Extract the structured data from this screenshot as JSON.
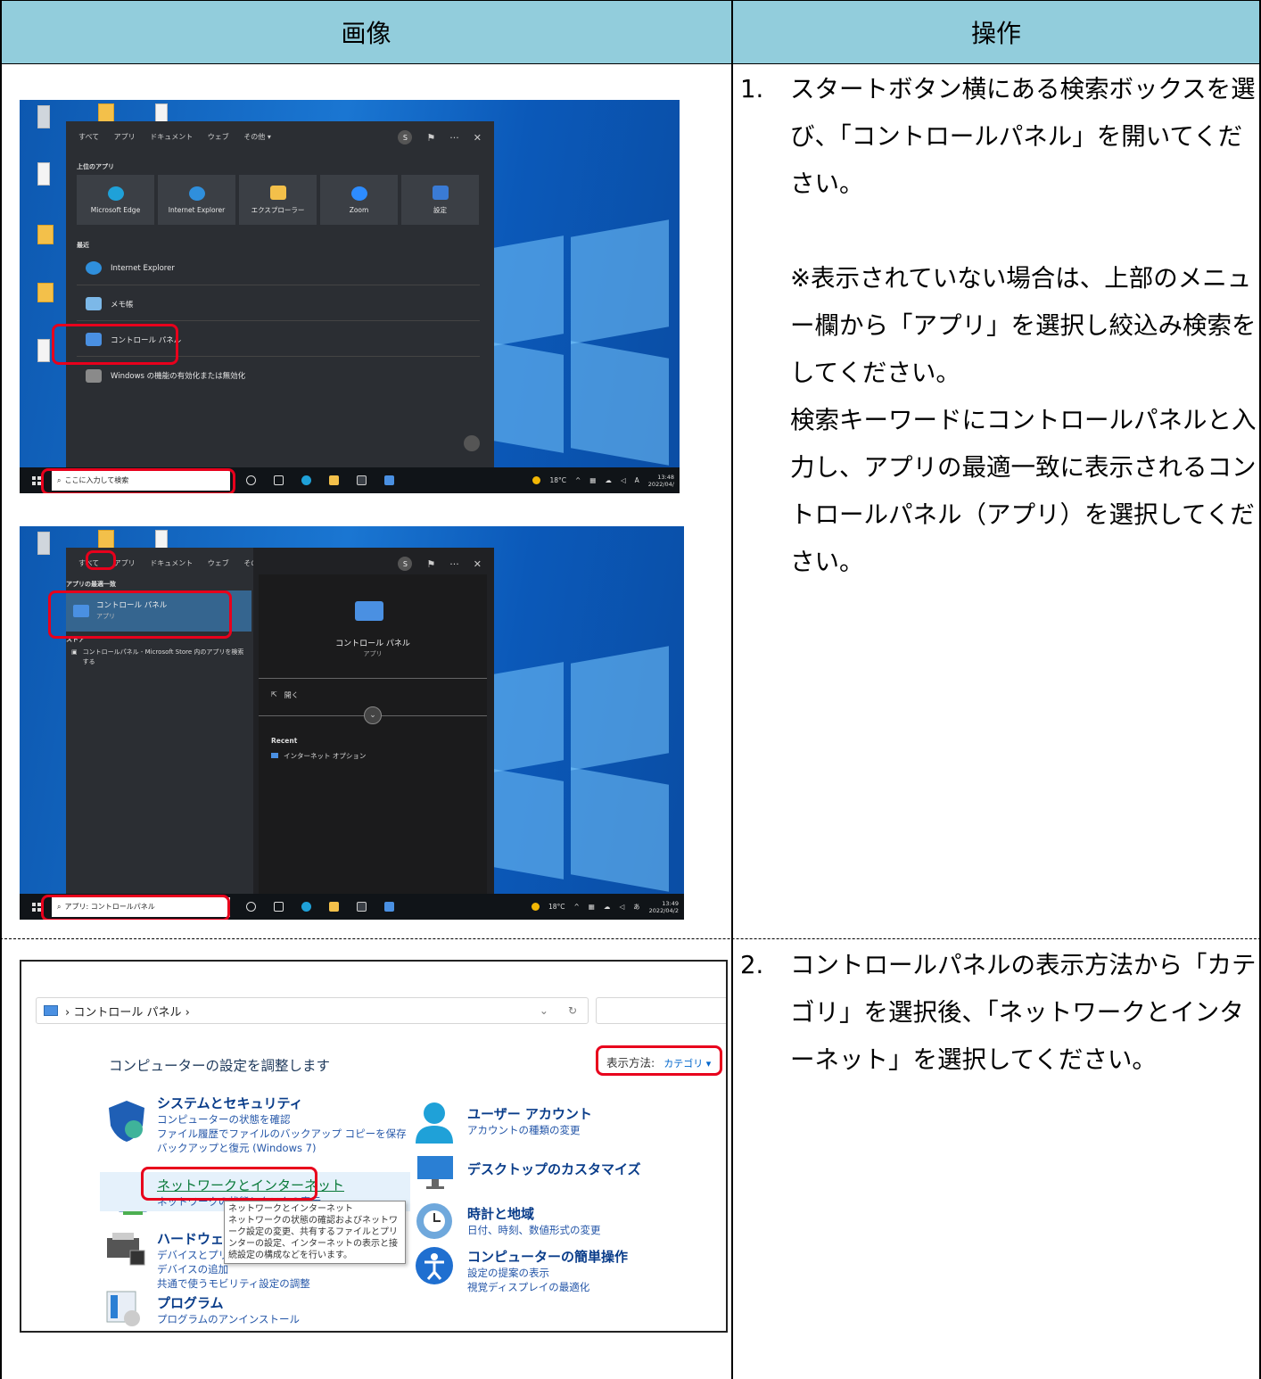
{
  "header": {
    "image_col": "画像",
    "operation_col": "操作"
  },
  "step1": {
    "num": "1.",
    "line1": "スタートボタン横にある検索ボックスを選び、「コントロールパネル」を開いてください。",
    "note1": "※表示されていない場合は、上部のメニュー欄から「アプリ」を選択し絞込み検索をしてください。",
    "note2": "検索キーワードにコントロールパネルと入力し、アプリの最適一致に表示されるコントロールパネル（アプリ）を選択してください。"
  },
  "step2": {
    "num": "2.",
    "line1": "コントロールパネルの表示方法から「カテゴリ」を選択後、「ネットワークとインターネット」を選択してください。"
  },
  "shot1": {
    "tabs": [
      "すべて",
      "アプリ",
      "ドキュメント",
      "ウェブ",
      "その他 ▾"
    ],
    "avatar": "S",
    "top_apps_label": "上位のアプリ",
    "tiles": [
      {
        "label": "Microsoft Edge",
        "color": "#1fa1d8"
      },
      {
        "label": "Internet Explorer",
        "color": "#2f8fdc"
      },
      {
        "label": "エクスプローラー",
        "color": "#f3c04a"
      },
      {
        "label": "Zoom",
        "color": "#2d8cff"
      },
      {
        "label": "設定",
        "color": "#3a7bd5"
      }
    ],
    "recent_label": "最近",
    "recent": [
      {
        "label": "Internet Explorer",
        "color": "#2f8fdc"
      },
      {
        "label": "メモ帳",
        "color": "#7cb8e8"
      },
      {
        "label": "コントロール パネル",
        "color": "#4a90e2"
      },
      {
        "label": "Windows の機能の有効化または無効化",
        "color": "#8a8a8a"
      }
    ],
    "search_text": "ここに入力して検索",
    "temp": "18°C",
    "ime": "A",
    "time": "13:48",
    "date": "2022/04/"
  },
  "shot2": {
    "tabs": [
      "すべて",
      "アプリ",
      "ドキュメント",
      "ウェブ",
      "その他 ▾"
    ],
    "avatar": "S",
    "best_match_label": "アプリの最適一致",
    "best_title": "コントロール パネル",
    "best_sub": "アプリ",
    "store_label": "ストア",
    "store_item": "コントロールパネル - Microsoft Store 内のアプリを検索する",
    "preview_title": "コントロール パネル",
    "preview_sub": "アプリ",
    "open_label": "開く",
    "recent_head": "Recent",
    "recent_item": "インターネット オプション",
    "search_text": "アプリ: コントロールパネル",
    "temp": "18°C",
    "ime": "あ",
    "time": "13:49",
    "date": "2022/04/2"
  },
  "cp": {
    "breadcrumb": "› コントロール パネル ›",
    "title": "コンピューターの設定を調整します",
    "viewby_label": "表示方法:",
    "viewby_value": "カテゴリ ▾",
    "system": {
      "head": "システムとセキュリティ",
      "l1": "コンピューターの状態を確認",
      "l2": "ファイル履歴でファイルのバックアップ コピーを保存",
      "l3": "バックアップと復元 (Windows 7)"
    },
    "network": {
      "head": "ネットワークとインターネット",
      "l1": "ネットワークの状態とタスクの表示"
    },
    "hardware": {
      "head": "ハードウェアとサウンド",
      "l1": "デバイスとプリンターの表示",
      "l2": "デバイスの追加",
      "l3": "共通で使うモビリティ設定の調整"
    },
    "program": {
      "head": "プログラム",
      "l1": "プログラムのアンインストール"
    },
    "user": {
      "head": "ユーザー アカウント",
      "l1": "アカウントの種類の変更"
    },
    "desktop": {
      "head": "デスクトップのカスタマイズ"
    },
    "clock": {
      "head": "時計と地域",
      "l1": "日付、時刻、数値形式の変更"
    },
    "ease": {
      "head": "コンピューターの簡単操作",
      "l1": "設定の提案の表示",
      "l2": "視覚ディスプレイの最適化"
    },
    "tooltip": "ネットワークとインターネット\nネットワークの状態の確認およびネットワーク設定の変更、共有するファイルとプリンターの設定、インターネットの表示と接続設定の構成などを行います。"
  }
}
